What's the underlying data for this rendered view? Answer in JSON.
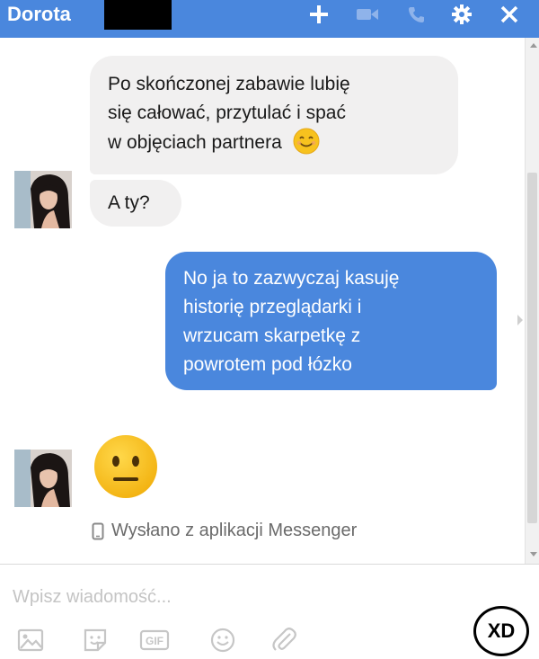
{
  "header": {
    "contact_name": "Dorota",
    "icons": [
      "plus-icon",
      "video-camera-icon",
      "phone-icon",
      "gear-icon",
      "close-icon"
    ]
  },
  "messages": {
    "incoming_1": {
      "lines": [
        "Po skończonej zabawie lubię",
        "się całować, przytulać i spać",
        "w objęciach partnera"
      ],
      "emoji": "smiling-face-icon"
    },
    "incoming_2": {
      "text": "A ty?"
    },
    "outgoing_1": {
      "lines": [
        "No ja to zazwyczaj kasuję",
        "historię przeglądarki i",
        "wrzucam skarpetkę z",
        "powrotem pod łózko"
      ]
    },
    "incoming_3": {
      "emoji": "neutral-face-icon"
    }
  },
  "sent_via": "Wysłano z aplikacji Messenger",
  "composer": {
    "placeholder": "Wpisz wiadomość...",
    "tools": [
      "photo-icon",
      "sticker-icon",
      "gif-icon",
      "emoji-icon",
      "paperclip-icon"
    ],
    "gif_label": "GIF"
  },
  "watermark": "XD",
  "colors": {
    "header_bg": "#4a87dd",
    "outgoing_bubble": "#4a87dd",
    "incoming_bubble": "#f1f0f0",
    "emoji_yellow": "#f7c21e"
  }
}
